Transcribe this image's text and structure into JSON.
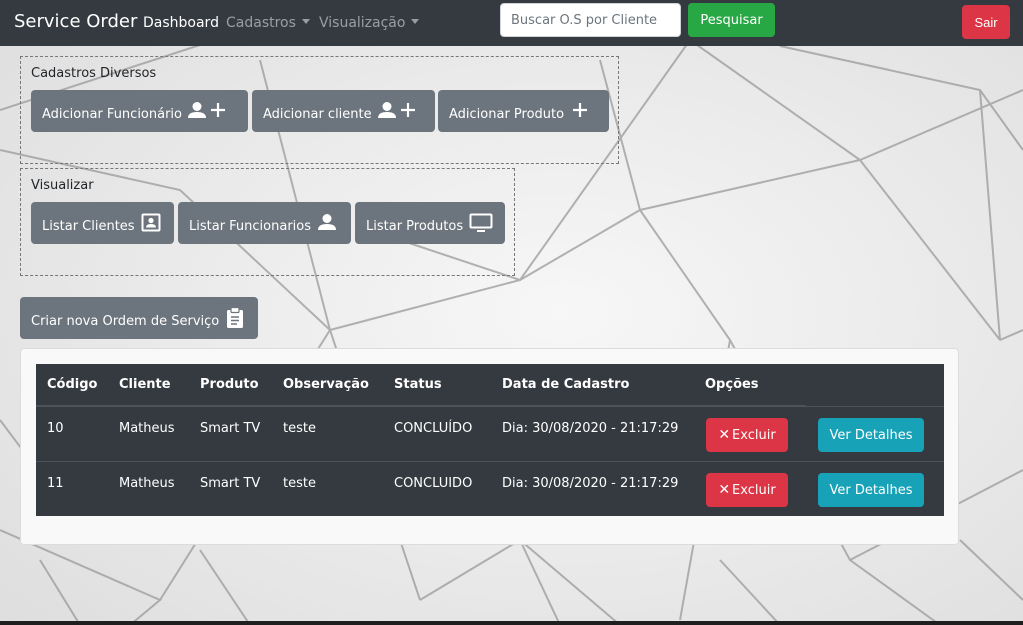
{
  "navbar": {
    "brand": "Service Order",
    "links": [
      {
        "label": "Dashboard"
      },
      {
        "label": "Cadastros"
      },
      {
        "label": "Visualização"
      }
    ],
    "search": {
      "placeholder": "Buscar O.S por Cliente",
      "value": "",
      "button_label": "Pesquisar"
    },
    "exit_label": "Sair"
  },
  "cadastros_box": {
    "title": "Cadastros Diversos",
    "buttons": [
      {
        "label": "Adicionar Funcionário",
        "icon": "person-plus-icon"
      },
      {
        "label": "Adicionar cliente",
        "icon": "person-plus-icon"
      },
      {
        "label": "Adicionar Produto",
        "icon": "plus-icon"
      }
    ]
  },
  "visualizar_box": {
    "title": "Visualizar",
    "buttons": [
      {
        "label": "Listar Clientes",
        "icon": "contact-card-icon"
      },
      {
        "label": "Listar Funcionarios",
        "icon": "person-icon"
      },
      {
        "label": "Listar Produtos",
        "icon": "monitor-icon"
      }
    ]
  },
  "new_order_button": {
    "label": "Criar nova Ordem de Serviço",
    "icon": "clipboard-icon"
  },
  "orders_table": {
    "headers": [
      "Código",
      "Cliente",
      "Produto",
      "Observação",
      "Status",
      "Data de Cadastro",
      "Opções"
    ],
    "rows": [
      {
        "codigo": "10",
        "cliente": "Matheus",
        "produto": "Smart TV",
        "observacao": "teste",
        "status": "CONCLUÍDO",
        "data": "Dia: 30/08/2020 - 21:17:29",
        "delete_label": "Excluir",
        "details_label": "Ver Detalhes"
      },
      {
        "codigo": "11",
        "cliente": "Matheus",
        "produto": "Smart TV",
        "observacao": "teste",
        "status": "CONCLUIDO",
        "data": "Dia: 30/08/2020 - 21:17:29",
        "delete_label": "Excluir",
        "details_label": "Ver Detalhes"
      }
    ]
  },
  "colors": {
    "navbar": "#343a40",
    "success": "#28a745",
    "danger": "#dc3545",
    "secondary": "#6c757d",
    "info": "#17a2b8"
  }
}
